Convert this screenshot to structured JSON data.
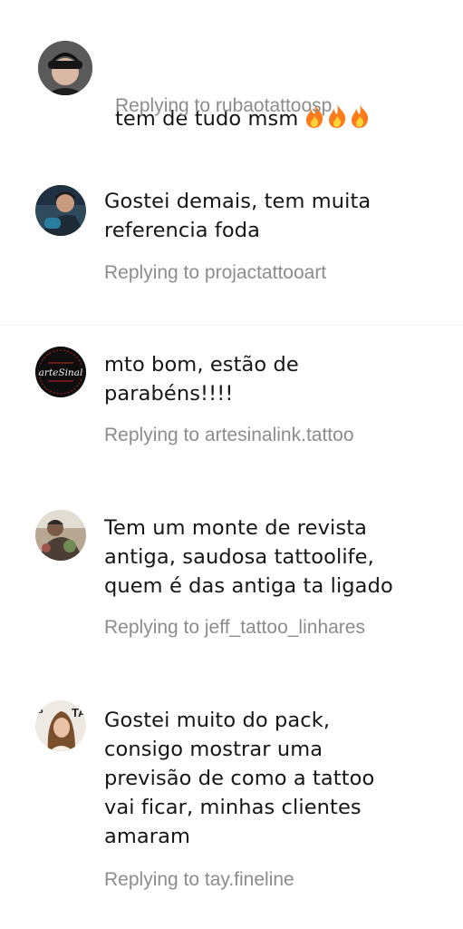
{
  "comments": [
    {
      "text": "tem de tudo msm",
      "emoji": "🔥🔥🔥",
      "reply_label": "Replying to rubaotattoosp",
      "avatar_icon": "profile-photo-man-cap-icon"
    },
    {
      "text": "Gostei demais, tem muita\nreferencia foda",
      "reply_label": "Replying to projactattooart",
      "avatar_icon": "profile-photo-tattoo-artist-icon"
    },
    {
      "text": "mto bom, estão de\nparabéns!!!!",
      "reply_label": "Replying to artesinalink.tattoo",
      "avatar_icon": "artesinal-logo-icon",
      "avatar_logo_text": "arteSinal"
    },
    {
      "text": "Tem um monte de revista\nantiga, saudosa tattoolife,\nquem é das antiga ta ligado",
      "reply_label": "Replying to jeff_tattoo_linhares",
      "avatar_icon": "profile-photo-tattoo-artist-icon"
    },
    {
      "text": "Gostei muito do pack,\nconsigo mostrar uma\nprevisão de como a tattoo\nvai ficar, minhas clientes\namaram",
      "reply_label": "Replying to tay.fineline",
      "avatar_icon": "profile-photo-woman-icon"
    }
  ],
  "colors": {
    "text": "#161616",
    "reply": "#8c8c8c",
    "fire": "#ff7a1a"
  }
}
